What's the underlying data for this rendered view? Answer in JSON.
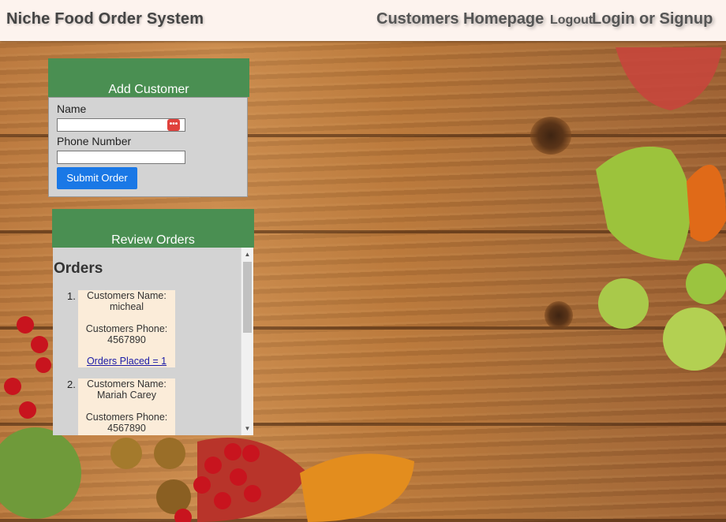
{
  "navbar": {
    "brand": "Niche Food Order System",
    "customers_homepage": "Customers Homepage",
    "logout": "Logout",
    "login_signup": "Login or Signup"
  },
  "add_customer": {
    "title": "Add Customer",
    "name_label": "Name",
    "name_value": "",
    "phone_label": "Phone Number",
    "phone_value": "",
    "submit_label": "Submit Order"
  },
  "review_orders": {
    "title": "Review Orders",
    "heading": "Orders",
    "orders": [
      {
        "num": "1.",
        "name_label": "Customers Name:",
        "name": "micheal",
        "phone_label": "Customers Phone:",
        "phone": "4567890",
        "orders_placed": "Orders Placed = 1"
      },
      {
        "num": "2.",
        "name_label": "Customers Name:",
        "name": "Mariah Carey",
        "phone_label": "Customers Phone:",
        "phone": "4567890"
      }
    ]
  },
  "colors": {
    "panel_header": "#4a8f52",
    "panel_body": "#d3d3d3",
    "submit_button": "#1a78e6",
    "order_card": "#fbecd9",
    "navbar": "#fdf3ee"
  }
}
